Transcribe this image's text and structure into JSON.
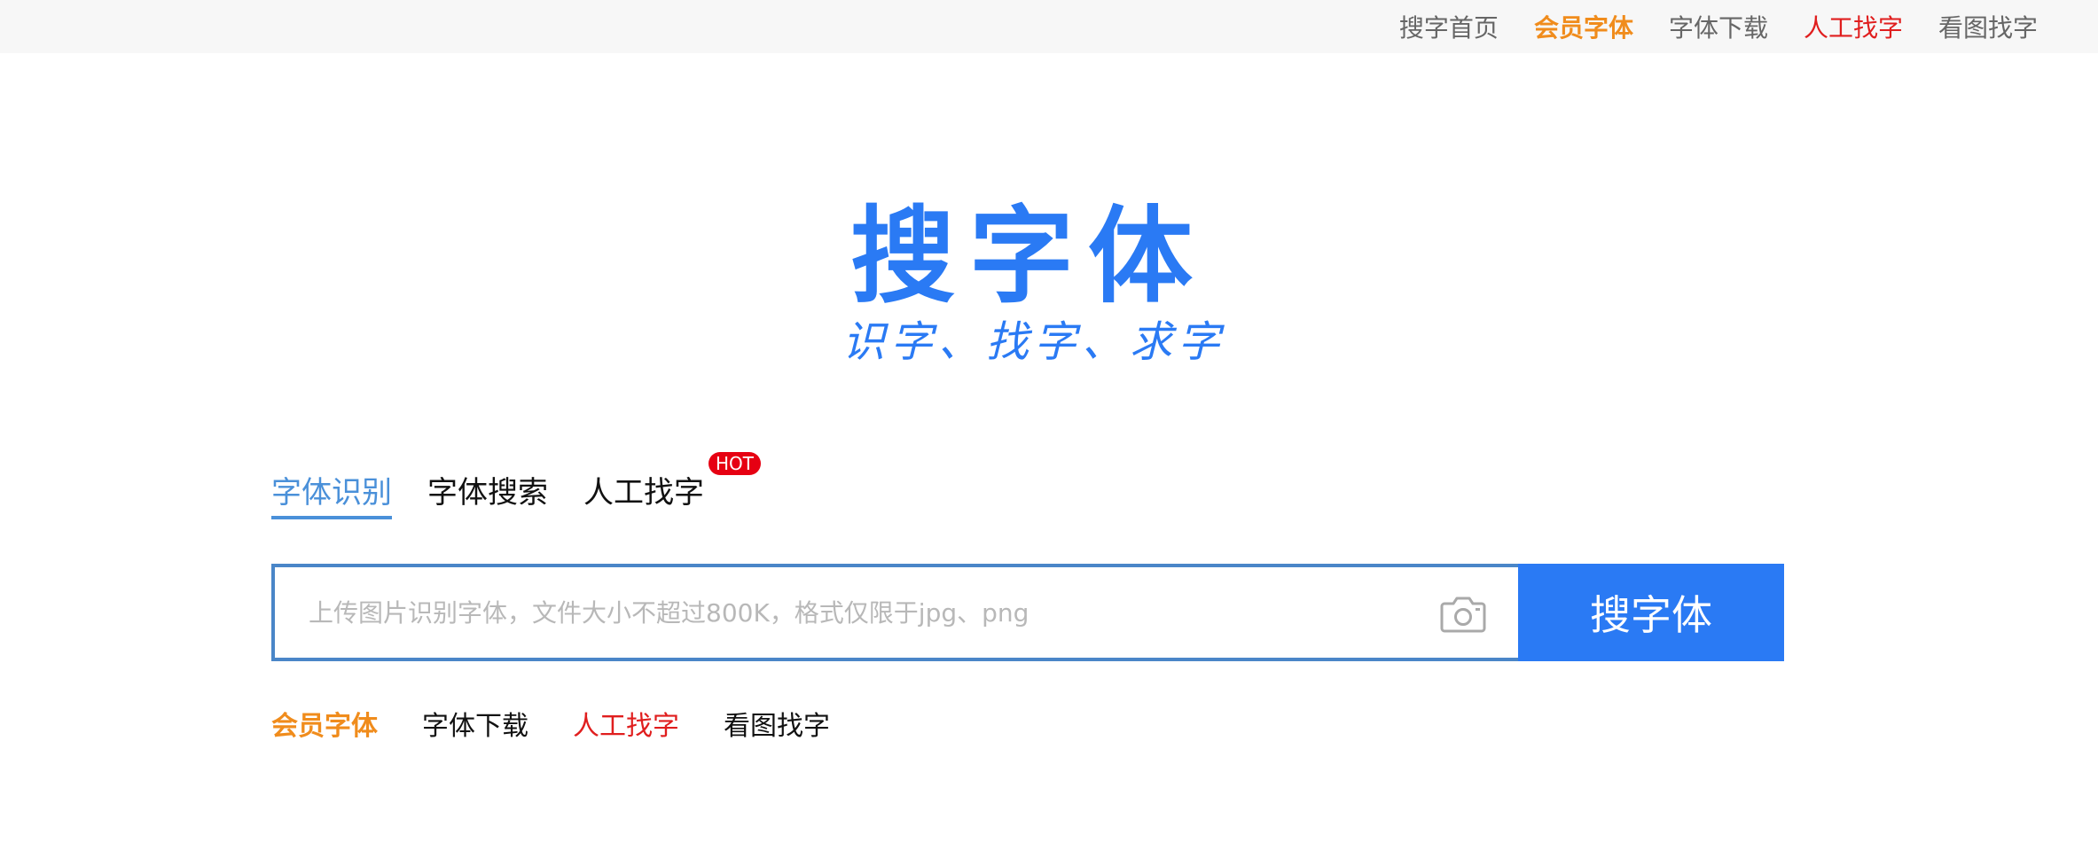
{
  "colors": {
    "brand_blue": "#2a7af4",
    "orange": "#f08c1c",
    "red": "#e01e1e",
    "hot_badge_bg": "#e60012",
    "tab_active": "#4a90d9"
  },
  "top_nav": [
    {
      "label": "搜字首页",
      "color": "#666666"
    },
    {
      "label": "会员字体",
      "color": "#f08c1c"
    },
    {
      "label": "字体下载",
      "color": "#666666"
    },
    {
      "label": "人工找字",
      "color": "#e01e1e"
    },
    {
      "label": "看图找字",
      "color": "#666666"
    }
  ],
  "logo": {
    "title": "搜字体",
    "slogan": "识字、找字、求字"
  },
  "tabs": [
    {
      "label": "字体识别",
      "active": true
    },
    {
      "label": "字体搜索",
      "active": false
    },
    {
      "label": "人工找字",
      "active": false,
      "badge": "HOT"
    }
  ],
  "search": {
    "value": "",
    "placeholder": "上传图片识别字体，文件大小不超过800K，格式仅限于jpg、png",
    "camera_icon": "camera-icon",
    "button_label": "搜字体"
  },
  "quick_links": [
    {
      "label": "会员字体",
      "color": "#f08c1c"
    },
    {
      "label": "字体下载",
      "color": "#111111"
    },
    {
      "label": "人工找字",
      "color": "#e01e1e"
    },
    {
      "label": "看图找字",
      "color": "#111111"
    }
  ]
}
